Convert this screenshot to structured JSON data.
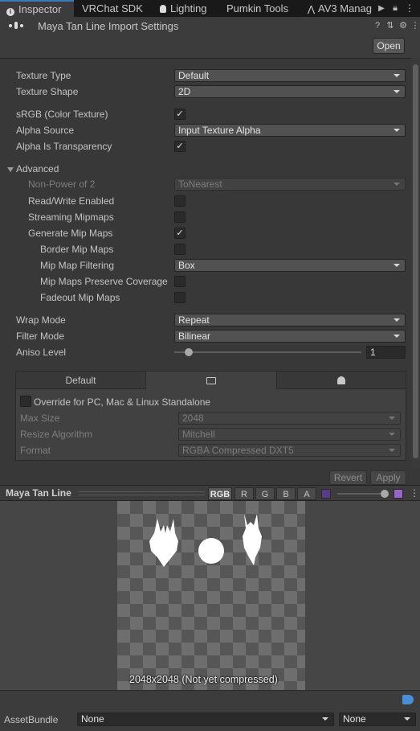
{
  "tabs": [
    {
      "label": "Inspector",
      "icon": "info-icon"
    },
    {
      "label": "VRChat SDK"
    },
    {
      "label": "Lighting",
      "icon": "bulb-icon"
    },
    {
      "label": "Pumkin Tools"
    },
    {
      "label": "AV3 Manag",
      "icon": "av3-icon"
    }
  ],
  "header": {
    "title": "Maya Tan Line Import Settings",
    "open_label": "Open"
  },
  "fields": {
    "texture_type": {
      "label": "Texture Type",
      "value": "Default"
    },
    "texture_shape": {
      "label": "Texture Shape",
      "value": "2D"
    },
    "srgb": {
      "label": "sRGB (Color Texture)",
      "checked": true
    },
    "alpha_source": {
      "label": "Alpha Source",
      "value": "Input Texture Alpha"
    },
    "alpha_transparency": {
      "label": "Alpha Is Transparency",
      "checked": true
    },
    "advanced": {
      "label": "Advanced"
    },
    "non_power_of_2": {
      "label": "Non-Power of 2",
      "value": "ToNearest"
    },
    "read_write": {
      "label": "Read/Write Enabled",
      "checked": false
    },
    "streaming_mipmaps": {
      "label": "Streaming Mipmaps",
      "checked": false
    },
    "generate_mipmaps": {
      "label": "Generate Mip Maps",
      "checked": true
    },
    "border_mipmaps": {
      "label": "Border Mip Maps",
      "checked": false
    },
    "mipmap_filtering": {
      "label": "Mip Map Filtering",
      "value": "Box"
    },
    "preserve_coverage": {
      "label": "Mip Maps Preserve Coverage",
      "checked": false
    },
    "fadeout_mipmaps": {
      "label": "Fadeout Mip Maps",
      "checked": false
    },
    "wrap_mode": {
      "label": "Wrap Mode",
      "value": "Repeat"
    },
    "filter_mode": {
      "label": "Filter Mode",
      "value": "Bilinear"
    },
    "aniso_level": {
      "label": "Aniso Level",
      "value": "1"
    }
  },
  "platform": {
    "tabs": [
      {
        "label": "Default"
      },
      {
        "icon": "monitor-icon"
      },
      {
        "icon": "android-icon"
      }
    ],
    "override_label": "Override for PC, Mac & Linux Standalone",
    "max_size": {
      "label": "Max Size",
      "value": "2048"
    },
    "resize": {
      "label": "Resize Algorithm",
      "value": "Mitchell"
    },
    "format": {
      "label": "Format",
      "value": "RGBA Compressed DXT5"
    }
  },
  "actions": {
    "revert": "Revert",
    "apply": "Apply"
  },
  "preview": {
    "title": "Maya Tan Line",
    "channels": [
      "RGB",
      "R",
      "G",
      "B",
      "A"
    ],
    "info": "2048x2048 (Not yet compressed)"
  },
  "assetbundle": {
    "label": "AssetBundle",
    "name": "None",
    "variant": "None"
  },
  "colors": {
    "background": "#383838",
    "tab_accent": "#3a79bb",
    "dropdown": "#515151"
  }
}
